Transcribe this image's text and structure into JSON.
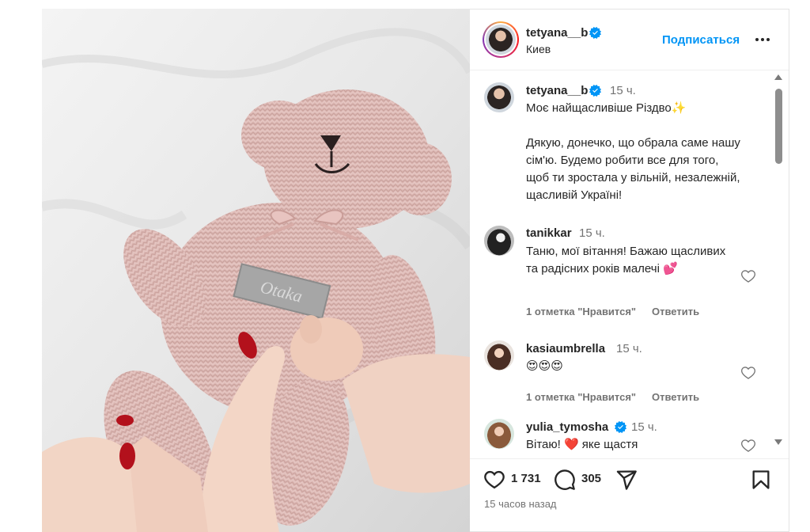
{
  "header": {
    "username": "tetyana__b",
    "location": "Киев",
    "follow_label": "Подписаться"
  },
  "caption": {
    "username": "tetyana__b",
    "time": "15 ч.",
    "line1": "Моє найщасливіше Різдво✨",
    "line2": "Дякую, донечко, що обрала саме нашу сім'ю. Будемо робити все для того, щоб ти зростала у вільній, незалежній, щасливій Україні!"
  },
  "comments": [
    {
      "username": "tanikkar",
      "time": "15 ч.",
      "text": "Таню, мої вітання! Бажаю щасливих та радісних років малечі 💕",
      "likes": "1 отметка \"Нравится\"",
      "reply": "Ответить"
    },
    {
      "username": "kasiaumbrella",
      "time": "15 ч.",
      "text": "😍😍😍",
      "likes": "1 отметка \"Нравится\"",
      "reply": "Ответить"
    },
    {
      "username": "yulia_tymosha",
      "time": "15 ч.",
      "text": "Вітаю! ❤️ яке щастя",
      "verified": true
    }
  ],
  "actions": {
    "likes_count": "1 731",
    "comments_count": "305",
    "posted_ago": "15 часов назад"
  },
  "photo": {
    "tag_text": "Otaka",
    "toy_color": "#dcb8b4"
  },
  "colors": {
    "accent": "#0095f6",
    "verified": "#0095f6",
    "muted": "#737373"
  },
  "icons": [
    "verified-icon",
    "more-icon",
    "heart-icon",
    "comment-icon",
    "share-icon",
    "bookmark-icon"
  ]
}
